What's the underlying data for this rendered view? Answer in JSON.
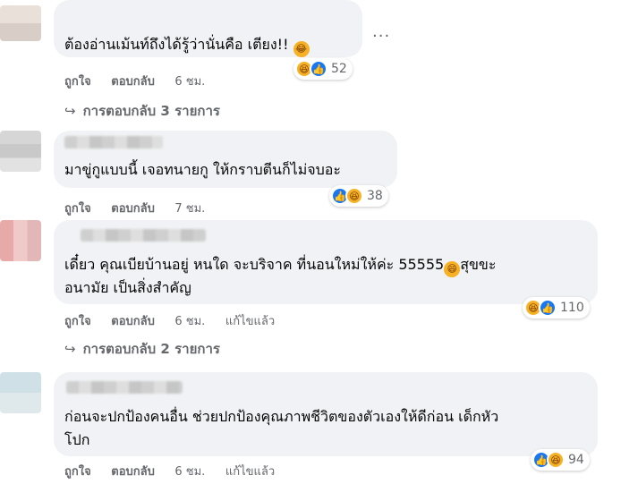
{
  "comments": [
    {
      "text": "ต้องอ่านเม้นท์ถึงได้รู้ว่านั่นคือ เตียง!!",
      "reaction_icons": [
        "haha-icon",
        "like-icon"
      ],
      "reaction_count": "52",
      "like_label": "ถูกใจ",
      "reply_label": "ตอบกลับ",
      "time": "6 ชม.",
      "replies_label": "การตอบกลับ 3 รายการ"
    },
    {
      "text": "มาขู่กูแบบนี้ เจอทนายกู ให้กราบตีนก็ไม่จบอะ",
      "reaction_icons": [
        "like-icon",
        "haha-icon"
      ],
      "reaction_count": "38",
      "like_label": "ถูกใจ",
      "reply_label": "ตอบกลับ",
      "time": "7 ชม."
    },
    {
      "text_line1": "เดี๋ยว คุณเบียบ้านอยู่ หนใด จะบริจาค ที่นอนใหม่ให้ค่ะ 55555",
      "text_line1_tail": "สุขขะ",
      "text_line2": "อนามัย เป็นสิ่งสำคัญ",
      "reaction_icons": [
        "haha-icon",
        "like-icon"
      ],
      "reaction_count": "110",
      "like_label": "ถูกใจ",
      "reply_label": "ตอบกลับ",
      "time": "6 ชม.",
      "edited_label": "แก้ไขแล้ว",
      "replies_label": "การตอบกลับ 2 รายการ"
    },
    {
      "text_line1": "ก่อนจะปกป้องคนอื่น ช่วยปกป้องคุณภาพชีวิตของตัวเองให้ดีก่อน เด็กหัว",
      "text_line2": "โปก",
      "reaction_icons": [
        "like-icon",
        "haha-icon"
      ],
      "reaction_count": "94",
      "like_label": "ถูกใจ",
      "reply_label": "ตอบกลับ",
      "time": "6 ชม.",
      "edited_label": "แก้ไขแล้ว"
    }
  ],
  "more_options": "···",
  "colors": {
    "bubble": "#f0f2f5",
    "meta_text": "#65676b",
    "like_blue": "#1877f2",
    "haha_yellow": "#f7b125"
  }
}
